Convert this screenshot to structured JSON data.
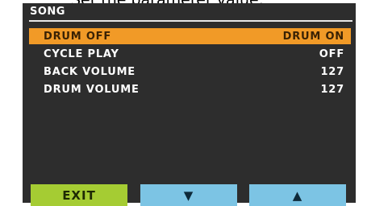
{
  "header_text": "Set the parameter value.",
  "screen": {
    "title": "SONG",
    "rows": [
      {
        "label": "DRUM OFF",
        "value": "DRUM ON",
        "selected": true
      },
      {
        "label": "CYCLE PLAY",
        "value": "OFF",
        "selected": false
      },
      {
        "label": "BACK VOLUME",
        "value": "127",
        "selected": false
      },
      {
        "label": "DRUM VOLUME",
        "value": "127",
        "selected": false
      }
    ]
  },
  "buttons": {
    "exit": "EXIT",
    "down": "▼",
    "up": "▲"
  },
  "colors": {
    "screen_bg": "#2d2d2d",
    "selection": "#f19a27",
    "exit_button": "#a5cc33",
    "arrow_button": "#7cc4e4"
  }
}
